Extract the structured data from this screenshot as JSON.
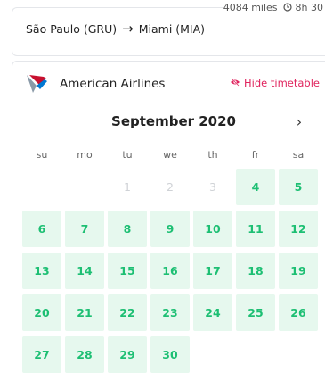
{
  "flight": {
    "distance": "4084 miles",
    "duration": "8h 30",
    "origin": "São Paulo (GRU)",
    "destination": "Miami (MIA)"
  },
  "airline": {
    "name": "American Airlines",
    "logo_icon": "american-airlines-logo",
    "hide_timetable_label": "Hide timetable"
  },
  "calendar": {
    "month_label": "September 2020",
    "weekdays": [
      "su",
      "mo",
      "tu",
      "we",
      "th",
      "fr",
      "sa"
    ],
    "days": [
      {
        "label": "",
        "state": "empty"
      },
      {
        "label": "",
        "state": "empty"
      },
      {
        "label": "1",
        "state": "inactive"
      },
      {
        "label": "2",
        "state": "inactive"
      },
      {
        "label": "3",
        "state": "inactive"
      },
      {
        "label": "4",
        "state": "active"
      },
      {
        "label": "5",
        "state": "active"
      },
      {
        "label": "6",
        "state": "active"
      },
      {
        "label": "7",
        "state": "active"
      },
      {
        "label": "8",
        "state": "active"
      },
      {
        "label": "9",
        "state": "active"
      },
      {
        "label": "10",
        "state": "active"
      },
      {
        "label": "11",
        "state": "active"
      },
      {
        "label": "12",
        "state": "active"
      },
      {
        "label": "13",
        "state": "active"
      },
      {
        "label": "14",
        "state": "active"
      },
      {
        "label": "15",
        "state": "active"
      },
      {
        "label": "16",
        "state": "active"
      },
      {
        "label": "17",
        "state": "active"
      },
      {
        "label": "18",
        "state": "active"
      },
      {
        "label": "19",
        "state": "active"
      },
      {
        "label": "20",
        "state": "active"
      },
      {
        "label": "21",
        "state": "active"
      },
      {
        "label": "22",
        "state": "active"
      },
      {
        "label": "23",
        "state": "active"
      },
      {
        "label": "24",
        "state": "active"
      },
      {
        "label": "25",
        "state": "active"
      },
      {
        "label": "26",
        "state": "active"
      },
      {
        "label": "27",
        "state": "active"
      },
      {
        "label": "28",
        "state": "active"
      },
      {
        "label": "29",
        "state": "active"
      },
      {
        "label": "30",
        "state": "active"
      }
    ]
  },
  "colors": {
    "active_bg": "#e6f8ee",
    "active_text": "#1dbf73",
    "hide_link": "#e0245e"
  }
}
